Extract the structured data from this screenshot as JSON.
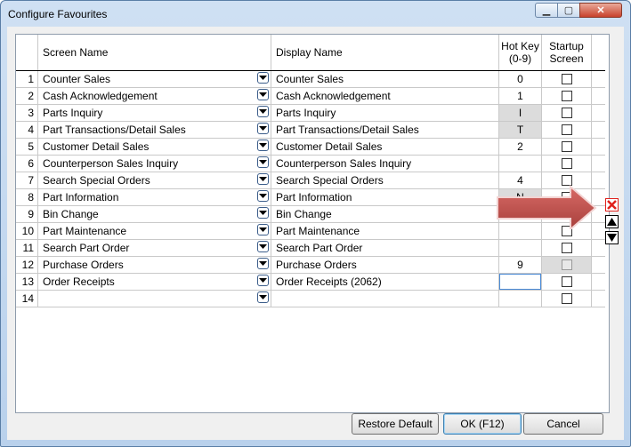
{
  "window": {
    "title": "Configure Favourites"
  },
  "columns": {
    "screen_name": "Screen Name",
    "display_name": "Display Name",
    "hot_key_line1": "Hot Key",
    "hot_key_line2": "(0-9)",
    "startup_line1": "Startup",
    "startup_line2": "Screen"
  },
  "rows": [
    {
      "n": "1",
      "screen": "Counter Sales",
      "display": "Counter Sales",
      "hotkey": "0",
      "hk_grey": false,
      "ss_grey": false
    },
    {
      "n": "2",
      "screen": "Cash Acknowledgement",
      "display": "Cash Acknowledgement",
      "hotkey": "1",
      "hk_grey": false,
      "ss_grey": false
    },
    {
      "n": "3",
      "screen": "Parts Inquiry",
      "display": "Parts Inquiry",
      "hotkey": "I",
      "hk_grey": true,
      "ss_grey": false
    },
    {
      "n": "4",
      "screen": "Part Transactions/Detail Sales",
      "display": "Part Transactions/Detail Sales",
      "hotkey": "T",
      "hk_grey": true,
      "ss_grey": false
    },
    {
      "n": "5",
      "screen": "Customer Detail Sales",
      "display": "Customer Detail Sales",
      "hotkey": "2",
      "hk_grey": false,
      "ss_grey": false
    },
    {
      "n": "6",
      "screen": "Counterperson Sales Inquiry",
      "display": "Counterperson Sales Inquiry",
      "hotkey": "",
      "hk_grey": false,
      "ss_grey": false
    },
    {
      "n": "7",
      "screen": "Search Special Orders",
      "display": "Search Special Orders",
      "hotkey": "4",
      "hk_grey": false,
      "ss_grey": false
    },
    {
      "n": "8",
      "screen": "Part Information",
      "display": "Part Information",
      "hotkey": "N",
      "hk_grey": true,
      "ss_grey": false
    },
    {
      "n": "9",
      "screen": "Bin Change",
      "display": "Bin Change",
      "hotkey": "",
      "hk_grey": false,
      "ss_grey": false
    },
    {
      "n": "10",
      "screen": "Part Maintenance",
      "display": "Part Maintenance",
      "hotkey": "",
      "hk_grey": false,
      "ss_grey": false
    },
    {
      "n": "11",
      "screen": "Search Part Order",
      "display": "Search Part Order",
      "hotkey": "",
      "hk_grey": false,
      "ss_grey": false
    },
    {
      "n": "12",
      "screen": "Purchase Orders",
      "display": "Purchase Orders",
      "hotkey": "9",
      "hk_grey": false,
      "ss_grey": true
    },
    {
      "n": "13",
      "screen": "Order Receipts",
      "display": "Order Receipts (2062)",
      "hotkey": "",
      "hk_grey": false,
      "ss_grey": false,
      "hk_active": true
    },
    {
      "n": "14",
      "screen": "",
      "display": "",
      "hotkey": "",
      "hk_grey": false,
      "ss_grey": false
    }
  ],
  "buttons": {
    "restore_default": "Restore Default",
    "ok": "OK (F12)",
    "cancel": "Cancel"
  },
  "colors": {
    "arrow": "#c0504d",
    "delete_icon": "#e0201b"
  },
  "icons": {
    "delete_row": "red-x-icon",
    "move_up": "up-triangle-icon",
    "move_down": "down-triangle-icon"
  }
}
